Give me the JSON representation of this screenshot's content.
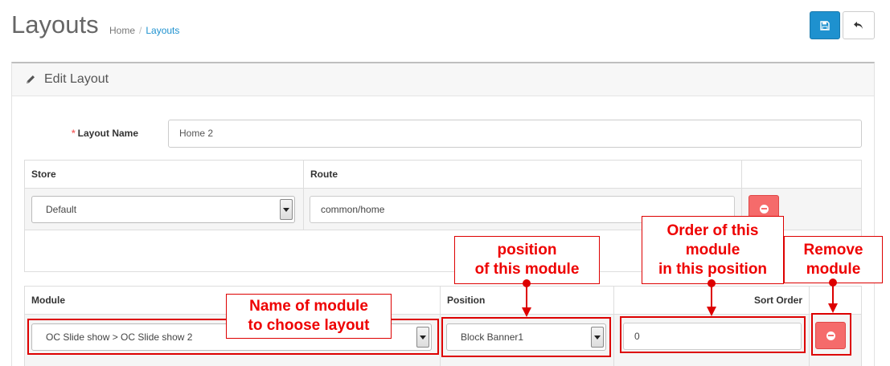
{
  "header": {
    "title": "Layouts",
    "breadcrumb": {
      "home": "Home",
      "current": "Layouts"
    }
  },
  "panel": {
    "heading": "Edit Layout"
  },
  "form": {
    "layout_name_label": "Layout Name",
    "layout_name_value": "Home 2"
  },
  "route_table": {
    "headers": {
      "store": "Store",
      "route": "Route"
    },
    "row": {
      "store": "Default",
      "route": "common/home"
    }
  },
  "module_table": {
    "headers": {
      "module": "Module",
      "position": "Position",
      "sort_order": "Sort Order"
    },
    "row": {
      "module": "OC Slide show > OC Slide show 2",
      "position": "Block Banner1",
      "sort_order": "0"
    }
  },
  "annotations": {
    "name": [
      "Name of module",
      "to choose layout"
    ],
    "position": [
      "position",
      "of this module"
    ],
    "order": [
      "Order of this",
      "module",
      "in this position"
    ],
    "remove": [
      "Remove",
      "module"
    ]
  },
  "colors": {
    "primary": "#1e91cf",
    "danger": "#f56b6b",
    "annotation": "#e00000"
  },
  "icons": {
    "save": "save-icon",
    "back": "reply-icon",
    "edit": "pencil-icon",
    "remove": "minus-circle-icon"
  }
}
